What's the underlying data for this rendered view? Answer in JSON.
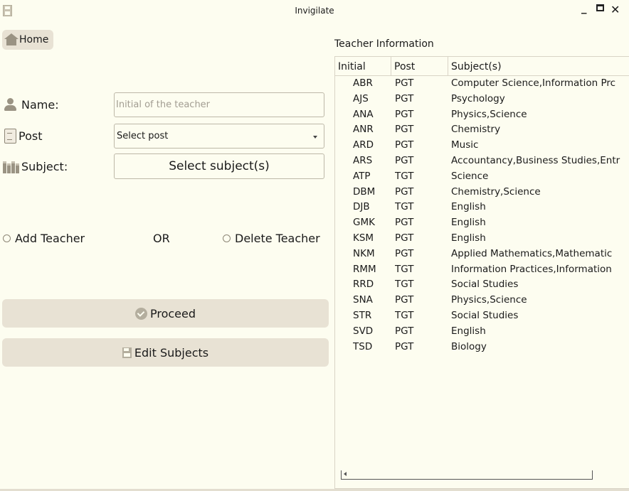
{
  "window": {
    "title": "Invigilate",
    "minimize": "_",
    "close": "✕"
  },
  "nav": {
    "home_label": "Home"
  },
  "form": {
    "name_label": "Name:",
    "name_placeholder": "Initial of the teacher",
    "name_value": "",
    "post_label": "Post",
    "post_selected": "Select post",
    "subject_label": "Subject:",
    "subject_button": "Select subject(s)",
    "add_teacher_label": "Add  Teacher",
    "or_label": "OR",
    "delete_teacher_label": "Delete Teacher",
    "proceed_label": "Proceed",
    "edit_subjects_label": "Edit Subjects"
  },
  "icons": {
    "app": "save-icon",
    "home": "home-icon",
    "name": "person-icon",
    "post": "clipboard-icon",
    "subject": "books-icon",
    "proceed": "check-circle-icon",
    "edit_subjects": "save-icon"
  },
  "teacher_table": {
    "title": "Teacher Information",
    "columns": [
      "Initial",
      "Post",
      "Subject(s)"
    ],
    "rows": [
      [
        "ABR",
        "PGT",
        "Computer Science,Information Prc"
      ],
      [
        "AJS",
        "PGT",
        "Psychology"
      ],
      [
        "ANA",
        "PGT",
        "Physics,Science"
      ],
      [
        "ANR",
        "PGT",
        "Chemistry"
      ],
      [
        "ARD",
        "PGT",
        "Music"
      ],
      [
        "ARS",
        "PGT",
        "Accountancy,Business Studies,Entr"
      ],
      [
        "ATP",
        "TGT",
        "Science"
      ],
      [
        "DBM",
        "PGT",
        "Chemistry,Science"
      ],
      [
        "DJB",
        "TGT",
        "English"
      ],
      [
        "GMK",
        "PGT",
        "English"
      ],
      [
        "KSM",
        "PGT",
        "English"
      ],
      [
        "NKM",
        "PGT",
        "Applied Mathematics,Mathematic"
      ],
      [
        "RMM",
        "TGT",
        "Information Practices,Information"
      ],
      [
        "RRD",
        "TGT",
        "Social Studies"
      ],
      [
        "SNA",
        "PGT",
        "Physics,Science"
      ],
      [
        "STR",
        "TGT",
        "Social Studies"
      ],
      [
        "SVD",
        "PGT",
        "English"
      ],
      [
        "TSD",
        "PGT",
        "Biology"
      ]
    ]
  },
  "colors": {
    "background": "#fdfdf0",
    "button": "#e8e2d4",
    "icon": "#9a9383",
    "border": "#bdb8a8"
  }
}
